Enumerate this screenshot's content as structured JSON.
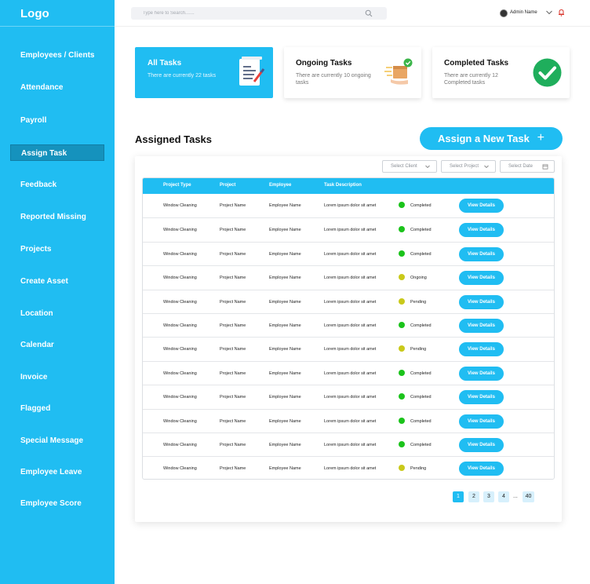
{
  "app": {
    "logo": "Logo"
  },
  "sidebar": {
    "items": [
      {
        "label": "Employees / Clients"
      },
      {
        "label": "Attendance"
      },
      {
        "label": "Payroll"
      },
      {
        "label": "Assign Task",
        "active": true
      },
      {
        "label": "Feedback"
      },
      {
        "label": "Reported Missing"
      },
      {
        "label": "Projects"
      },
      {
        "label": "Create Asset"
      },
      {
        "label": "Location"
      },
      {
        "label": "Calendar"
      },
      {
        "label": "Invoice"
      },
      {
        "label": "Flagged"
      },
      {
        "label": "Special Message"
      },
      {
        "label": "Employee Leave"
      },
      {
        "label": "Employee Score"
      }
    ]
  },
  "topbar": {
    "search_placeholder": "Type here to Search.......",
    "admin_name": "Admin Name",
    "icons": [
      "search-icon",
      "avatar",
      "chevron-down-icon",
      "bell-icon"
    ]
  },
  "cards": [
    {
      "title": "All Tasks",
      "subtitle": "There are currently 22 tasks",
      "icon": "document-pen-icon",
      "active": true
    },
    {
      "title": "Ongoing Tasks",
      "subtitle": "There are currently 10 ongoing tasks",
      "icon": "package-delivery-icon",
      "active": false
    },
    {
      "title": "Completed Tasks",
      "subtitle": "There are currently 12 Completed tasks",
      "icon": "check-circle-icon",
      "active": false
    }
  ],
  "section": {
    "title": "Assigned Tasks",
    "assign_button": "Assign a New Task",
    "assign_icon": "+"
  },
  "filters": {
    "client": "Select Client",
    "project": "Select Project",
    "date": "Select Date"
  },
  "table": {
    "headers": [
      "Project Type",
      "Project",
      "Employee",
      "Task Description"
    ],
    "action_label": "View Details",
    "status_colors": {
      "Completed": "#1bc31b",
      "Ongoing": "#c9c91a",
      "Pending": "#c9c91a"
    },
    "rows": [
      {
        "project_type": "Window Cleaning",
        "project": "Project Name",
        "employee": "Employee Name",
        "description": "Lorem ipsum dolor sit amet",
        "status": "Completed"
      },
      {
        "project_type": "Window Cleaning",
        "project": "Project Name",
        "employee": "Employee Name",
        "description": "Lorem ipsum dolor sit amet",
        "status": "Completed"
      },
      {
        "project_type": "Window Cleaning",
        "project": "Project Name",
        "employee": "Employee Name",
        "description": "Lorem ipsum dolor sit amet",
        "status": "Completed"
      },
      {
        "project_type": "Window Cleaning",
        "project": "Project Name",
        "employee": "Employee Name",
        "description": "Lorem ipsum dolor sit amet",
        "status": "Ongoing"
      },
      {
        "project_type": "Window Cleaning",
        "project": "Project Name",
        "employee": "Employee Name",
        "description": "Lorem ipsum dolor sit amet",
        "status": "Pending"
      },
      {
        "project_type": "Window Cleaning",
        "project": "Project Name",
        "employee": "Employee Name",
        "description": "Lorem ipsum dolor sit amet",
        "status": "Completed"
      },
      {
        "project_type": "Window Cleaning",
        "project": "Project Name",
        "employee": "Employee Name",
        "description": "Lorem ipsum dolor sit amet",
        "status": "Pending"
      },
      {
        "project_type": "Window Cleaning",
        "project": "Project Name",
        "employee": "Employee Name",
        "description": "Lorem ipsum dolor sit amet",
        "status": "Completed"
      },
      {
        "project_type": "Window Cleaning",
        "project": "Project Name",
        "employee": "Employee Name",
        "description": "Lorem ipsum dolor sit amet",
        "status": "Completed"
      },
      {
        "project_type": "Window Cleaning",
        "project": "Project Name",
        "employee": "Employee Name",
        "description": "Lorem ipsum dolor sit amet",
        "status": "Completed"
      },
      {
        "project_type": "Window Cleaning",
        "project": "Project Name",
        "employee": "Employee Name",
        "description": "Lorem ipsum dolor sit amet",
        "status": "Completed"
      },
      {
        "project_type": "Window Cleaning",
        "project": "Project Name",
        "employee": "Employee Name",
        "description": "Lorem ipsum dolor sit amet",
        "status": "Pending"
      }
    ]
  },
  "pagination": {
    "pages": [
      "1",
      "2",
      "3",
      "4"
    ],
    "ellipsis": "...",
    "last": "40",
    "current": "1"
  },
  "colors": {
    "accent": "#20BDF2",
    "sidebar_active": "#1592BD"
  }
}
